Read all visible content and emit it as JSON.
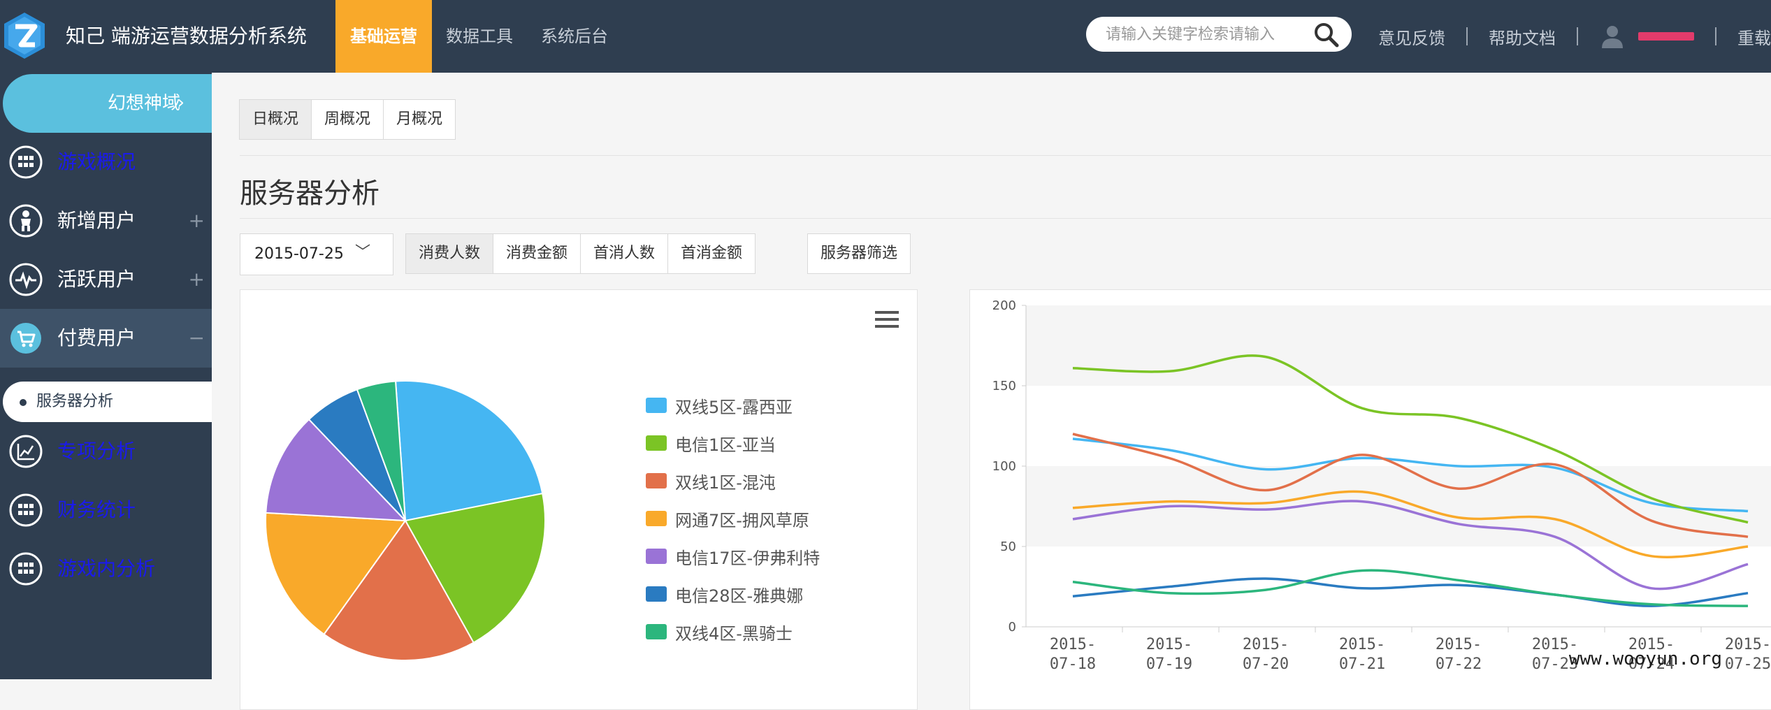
{
  "app": {
    "title": "知己 端游运营数据分析系统",
    "brand_color": "#2f3e50",
    "accent_color": "#f9a92a"
  },
  "topnav": {
    "tabs": [
      {
        "label": "基础运营",
        "active": true
      },
      {
        "label": "数据工具",
        "active": false
      },
      {
        "label": "系统后台",
        "active": false
      }
    ]
  },
  "search": {
    "placeholder": "请输入关键字检索请输入",
    "icon": "search-icon"
  },
  "toplinks": {
    "feedback": "意见反馈",
    "help": "帮助文档",
    "reset": "重载"
  },
  "sidebar": {
    "game": "幻想神域",
    "items": [
      {
        "label": "游戏概况",
        "icon": "grid-icon",
        "style": "link"
      },
      {
        "label": "新增用户",
        "icon": "baby-icon",
        "style": "white",
        "toggle": "+"
      },
      {
        "label": "活跃用户",
        "icon": "pulse-icon",
        "style": "white",
        "toggle": "+"
      },
      {
        "label": "付费用户",
        "icon": "cart-icon",
        "style": "white",
        "toggle": "−",
        "active": true
      },
      {
        "label": "专项分析",
        "icon": "trend-icon",
        "style": "link"
      },
      {
        "label": "财务统计",
        "icon": "grid-icon",
        "style": "link"
      },
      {
        "label": "游戏内分析",
        "icon": "grid-icon",
        "style": "link"
      }
    ],
    "sub_item": "服务器分析"
  },
  "main": {
    "period_tabs": [
      "日概况",
      "周概况",
      "月概况"
    ],
    "period_active": 0,
    "page_title": "服务器分析",
    "date": "2015-07-25",
    "metric_tabs": [
      "消费人数",
      "消费金额",
      "首消人数",
      "首消金额"
    ],
    "metric_active": 0,
    "server_filter": "服务器筛选"
  },
  "chart_data": [
    {
      "type": "pie",
      "series": [
        {
          "name": "双线5区-露西亚",
          "value": 23,
          "color": "#45b6f2"
        },
        {
          "name": "电信1区-亚当",
          "value": 20,
          "color": "#7bc425"
        },
        {
          "name": "双线1区-混沌",
          "value": 18,
          "color": "#e2704a"
        },
        {
          "name": "网通7区-拥风草原",
          "value": 16,
          "color": "#f9a92a"
        },
        {
          "name": "电信17区-伊弗利特",
          "value": 12,
          "color": "#9a73d6"
        },
        {
          "name": "电信28区-雅典娜",
          "value": 6.5,
          "color": "#2a7bc1"
        },
        {
          "name": "双线4区-黑骑士",
          "value": 4.5,
          "color": "#2cb67d"
        }
      ]
    },
    {
      "type": "line",
      "categories": [
        "2015-07-18",
        "2015-07-19",
        "2015-07-20",
        "2015-07-21",
        "2015-07-22",
        "2015-07-23",
        "2015-07-24",
        "2015-07-25"
      ],
      "ylim": [
        0,
        200
      ],
      "yticks": [
        0,
        50,
        100,
        150,
        200
      ],
      "series": [
        {
          "name": "双线5区-露西亚",
          "color": "#45b6f2",
          "values": [
            117,
            110,
            98,
            105,
            100,
            99,
            77,
            72
          ]
        },
        {
          "name": "电信1区-亚当",
          "color": "#7bc425",
          "values": [
            161,
            159,
            168,
            136,
            130,
            110,
            80,
            65
          ]
        },
        {
          "name": "双线1区-混沌",
          "color": "#e2704a",
          "values": [
            120,
            105,
            85,
            107,
            86,
            101,
            66,
            56
          ]
        },
        {
          "name": "网通7区-拥风草原",
          "color": "#f9a92a",
          "values": [
            74,
            78,
            77,
            84,
            68,
            67,
            44,
            50
          ]
        },
        {
          "name": "电信17区-伊弗利特",
          "color": "#9a73d6",
          "values": [
            67,
            75,
            73,
            78,
            64,
            56,
            24,
            39
          ]
        },
        {
          "name": "电信28区-雅典娜",
          "color": "#2a7bc1",
          "values": [
            19,
            25,
            30,
            24,
            26,
            20,
            13,
            21
          ]
        },
        {
          "name": "双线4区-黑骑士",
          "color": "#2cb67d",
          "values": [
            28,
            21,
            23,
            35,
            29,
            20,
            14,
            13
          ]
        }
      ]
    }
  ],
  "watermark": "www.wooyun.org"
}
